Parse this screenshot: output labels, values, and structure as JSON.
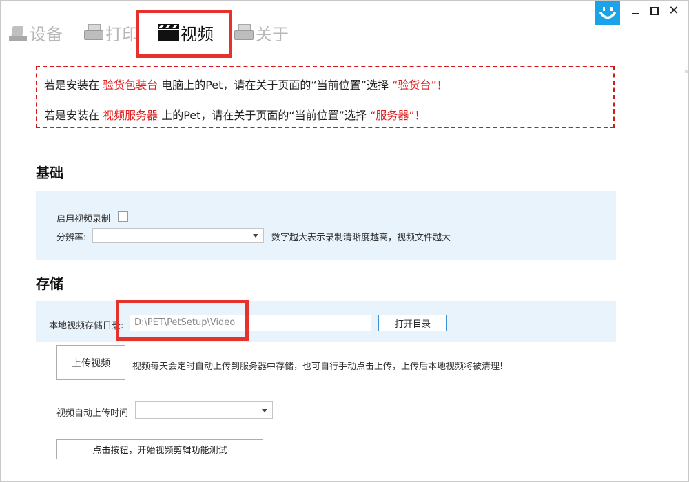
{
  "tabs": {
    "device": "设备",
    "print": "打印",
    "video": "视频",
    "about": "关于",
    "active": "video"
  },
  "notice": {
    "line1": {
      "a": "若是安装在 ",
      "b": "验货包装台",
      "c": " 电脑上的Pet，请在关于页面的“当前位置”选择 ",
      "d": "“验货台”！"
    },
    "line2": {
      "a": "若是安装在 ",
      "b": "视频服务器",
      "c": " 上的Pet，请在关于页面的“当前位置”选择 ",
      "d": "“服务器”！"
    }
  },
  "basic": {
    "title": "基础",
    "enable_recording_label": "启用视频录制",
    "enable_recording_checked": false,
    "resolution_label": "分辨率:",
    "resolution_value": "",
    "resolution_hint": "数字越大表示录制清晰度越高，视频文件越大"
  },
  "storage": {
    "title": "存储",
    "local_dir_label": "本地视频存储目录:",
    "local_dir_value": "D:\\PET\\PetSetup\\Video",
    "open_dir_button": "打开目录",
    "upload_button": "上传视频",
    "upload_hint": "视频每天会定时自动上传到服务器中存储，也可自行手动点击上传，上传后本地视频将被清理!",
    "auto_upload_label": "视频自动上传时间",
    "auto_upload_value": "",
    "test_button": "点击按钮，开始视频剪辑功能测试"
  },
  "colors": {
    "accent": "#1aa3e8",
    "highlight": "#e5322d",
    "notice_red": "#e02020",
    "panel_bg": "#e8f3fb"
  }
}
